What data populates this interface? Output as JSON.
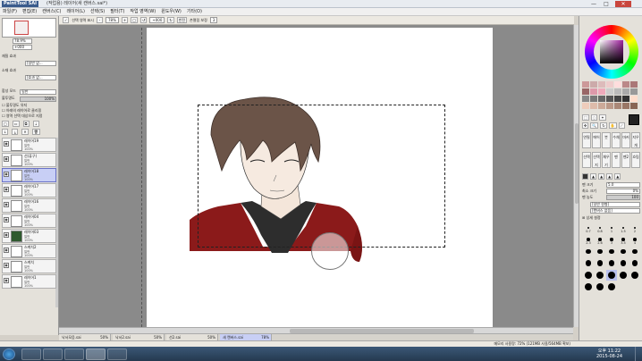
{
  "window": {
    "logo": "PaintTool SAI",
    "title": "(작업용) 레이어(새 캔버스.sai*)",
    "min": "—",
    "max": "□",
    "close": "✕"
  },
  "menu": [
    "파일(F)",
    "편집(E)",
    "캔버스(C)",
    "레이어(L)",
    "선택(S)",
    "필터(T)",
    "작업 영역(W)",
    "윈도우(W)",
    "기타(O)"
  ],
  "toolbar": {
    "show_selection": "선택 영역 표시",
    "zoom": "78%",
    "angle": "+000",
    "flip": "반전",
    "stabilizer_label": "손떨림 보정",
    "stabilizer_value": "3"
  },
  "left": {
    "zoom_value": "78.9%",
    "angle_value": "+000",
    "texture_label": "재질 효과",
    "texture_value": "[일반 없...",
    "effect_label": "소재 효과",
    "effect_value": "[효과 없...",
    "blend_label": "합성 모드",
    "blend_value": "일반",
    "opacity_label": "불투명도",
    "opacity_value": "100%",
    "protect_opacity": "불투명도 유지",
    "clip_group": "아래의 레이어로 클리핑",
    "select_source": "영역 선택 대상으로 지정",
    "layers": [
      {
        "name": "레이어19",
        "mode": "일반",
        "opacity": "100%"
      },
      {
        "name": "선(퓨구)",
        "mode": "일반",
        "opacity": "100%"
      },
      {
        "name": "레이어18",
        "mode": "일반",
        "opacity": "100%"
      },
      {
        "name": "레이어17",
        "mode": "일반",
        "opacity": "100%"
      },
      {
        "name": "레이어16",
        "mode": "일반",
        "opacity": "100%"
      },
      {
        "name": "레이어04",
        "mode": "일반",
        "opacity": "100%"
      },
      {
        "name": "레이어03",
        "mode": "일반",
        "opacity": "100%"
      },
      {
        "name": "스케치2",
        "mode": "일반",
        "opacity": "100%"
      },
      {
        "name": "스케치",
        "mode": "일반",
        "opacity": "100%"
      },
      {
        "name": "레이어1",
        "mode": "일반",
        "opacity": "100%"
      }
    ]
  },
  "docs": [
    {
      "name": "낙서모음.sai",
      "zoom": "50%"
    },
    {
      "name": "낙서2.sai",
      "zoom": "50%"
    },
    {
      "name": "선2.sai",
      "zoom": "50%"
    },
    {
      "name": "새 캔버스.sai",
      "zoom": "78%"
    }
  ],
  "right": {
    "size_label": "펜 크기",
    "size_value": "5.0",
    "min_size_label": "최소 크기",
    "min_size_value": "0%",
    "density_label": "펜 농도",
    "density_value": "100",
    "shape_value": "[일반 원형]",
    "texture_value": "[캔버스 없음]",
    "detail_label": "상세 설정",
    "tools": [
      "연필",
      "에어",
      "붓",
      "수채",
      "마커",
      "지우개",
      "선택",
      "선택지",
      "채우기",
      "펜",
      "펜2",
      "흐림"
    ],
    "brush_sizes": [
      "0.7",
      "0.8",
      "1",
      "1.5",
      "2",
      "2.3",
      "2.6",
      "3",
      "3.5",
      "4",
      "5",
      "6",
      "7",
      "8",
      "9",
      "10",
      "12",
      "14",
      "16",
      "20",
      "25",
      "30",
      "35",
      "40",
      "50",
      "60",
      "70",
      "80"
    ]
  },
  "status": {
    "memory": "메모리 사용량: 72% (121MB 사용/564MB 확보)"
  },
  "clock": {
    "time": "오후 11:22",
    "date": "2015-08-24"
  },
  "colors": {
    "canvas_bg": "#8a8a8a",
    "selection_layer": "#c8cff5",
    "jacket": "#8b1a1a",
    "hair": "#6b5448"
  }
}
